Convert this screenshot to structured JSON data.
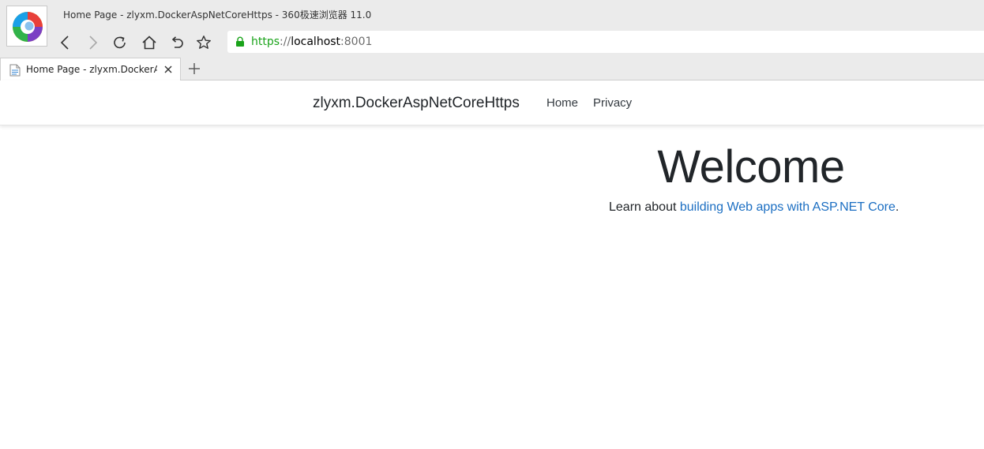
{
  "browser": {
    "window_title": "Home Page - zlyxm.DockerAspNetCoreHttps - 360极速浏览器 11.0",
    "address": {
      "scheme": "https",
      "separator": "://",
      "host": "localhost",
      "port": ":8001"
    },
    "tabs": [
      {
        "label": "Home Page - zlyxm.DockerAspNetCoreHttps"
      }
    ],
    "icons": {
      "logo": "360-browser-logo-icon",
      "back": "back-arrow-icon",
      "forward": "forward-arrow-icon",
      "reload": "reload-icon",
      "home": "home-icon",
      "undo": "undo-icon",
      "bookmark": "star-icon",
      "secure": "lock-icon",
      "new_tab": "plus-icon",
      "close_tab": "close-icon"
    },
    "colors": {
      "secure_scheme": "#1aa31a",
      "chrome_bg": "#ebebeb"
    }
  },
  "site": {
    "brand": "zlyxm.DockerAspNetCoreHttps",
    "nav": [
      {
        "label": "Home"
      },
      {
        "label": "Privacy"
      }
    ],
    "main": {
      "heading": "Welcome",
      "lead_prefix": "Learn about ",
      "lead_link": "building Web apps with ASP.NET Core",
      "lead_suffix": "."
    },
    "colors": {
      "link": "#1b6ec2",
      "text": "#212529"
    }
  }
}
